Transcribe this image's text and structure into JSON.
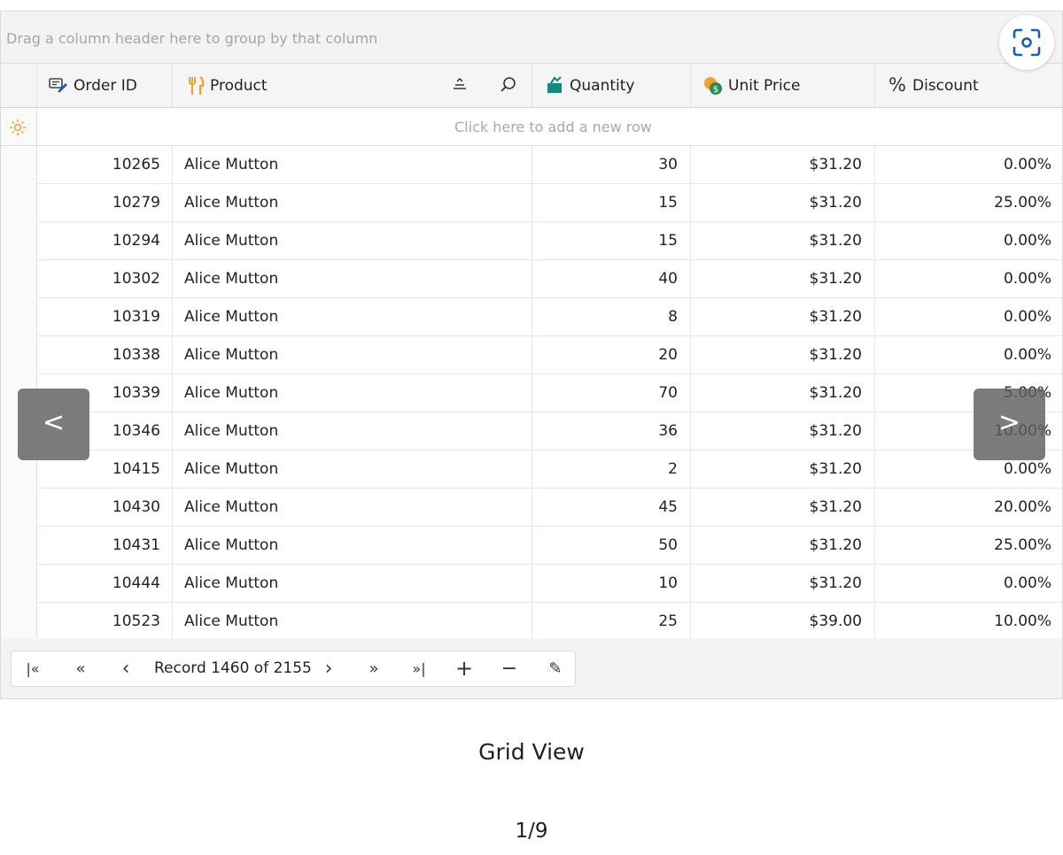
{
  "group_panel": {
    "hint": "Drag a column header here to group by that column"
  },
  "columns": [
    {
      "label": "Order ID",
      "icon": "order-id-icon"
    },
    {
      "label": "Product",
      "icon": "product-icon"
    },
    {
      "label": "Quantity",
      "icon": "quantity-icon"
    },
    {
      "label": "Unit Price",
      "icon": "unit-price-icon"
    },
    {
      "label": "Discount",
      "icon": "percent-icon"
    }
  ],
  "new_row": {
    "text": "Click here to add a new row"
  },
  "rows": [
    {
      "order_id": "10265",
      "product": "Alice Mutton",
      "quantity": "30",
      "unit_price": "$31.20",
      "discount": "0.00%"
    },
    {
      "order_id": "10279",
      "product": "Alice Mutton",
      "quantity": "15",
      "unit_price": "$31.20",
      "discount": "25.00%"
    },
    {
      "order_id": "10294",
      "product": "Alice Mutton",
      "quantity": "15",
      "unit_price": "$31.20",
      "discount": "0.00%"
    },
    {
      "order_id": "10302",
      "product": "Alice Mutton",
      "quantity": "40",
      "unit_price": "$31.20",
      "discount": "0.00%"
    },
    {
      "order_id": "10319",
      "product": "Alice Mutton",
      "quantity": "8",
      "unit_price": "$31.20",
      "discount": "0.00%"
    },
    {
      "order_id": "10338",
      "product": "Alice Mutton",
      "quantity": "20",
      "unit_price": "$31.20",
      "discount": "0.00%"
    },
    {
      "order_id": "10339",
      "product": "Alice Mutton",
      "quantity": "70",
      "unit_price": "$31.20",
      "discount": "5.00%"
    },
    {
      "order_id": "10346",
      "product": "Alice Mutton",
      "quantity": "36",
      "unit_price": "$31.20",
      "discount": "10.00%"
    },
    {
      "order_id": "10415",
      "product": "Alice Mutton",
      "quantity": "2",
      "unit_price": "$31.20",
      "discount": "0.00%"
    },
    {
      "order_id": "10430",
      "product": "Alice Mutton",
      "quantity": "45",
      "unit_price": "$31.20",
      "discount": "20.00%"
    },
    {
      "order_id": "10431",
      "product": "Alice Mutton",
      "quantity": "50",
      "unit_price": "$31.20",
      "discount": "25.00%"
    },
    {
      "order_id": "10444",
      "product": "Alice Mutton",
      "quantity": "10",
      "unit_price": "$31.20",
      "discount": "0.00%"
    },
    {
      "order_id": "10523",
      "product": "Alice Mutton",
      "quantity": "25",
      "unit_price": "$39.00",
      "discount": "10.00%"
    }
  ],
  "navigator": {
    "first": "|«",
    "prev_page": "«",
    "prev": "‹",
    "record_text": "Record 1460 of 2155",
    "next": "›",
    "next_page": "»",
    "last": "»|",
    "add": "+",
    "remove": "−",
    "edit": "✎"
  },
  "slideshow": {
    "prev_arrow": "<",
    "next_arrow": ">",
    "caption": "Grid View",
    "counter": "1/9"
  },
  "colors": {
    "accent_blue": "#1a5fb4",
    "icon_orange": "#f0a030",
    "icon_teal": "#16897f",
    "icon_green": "#2e8b57"
  }
}
